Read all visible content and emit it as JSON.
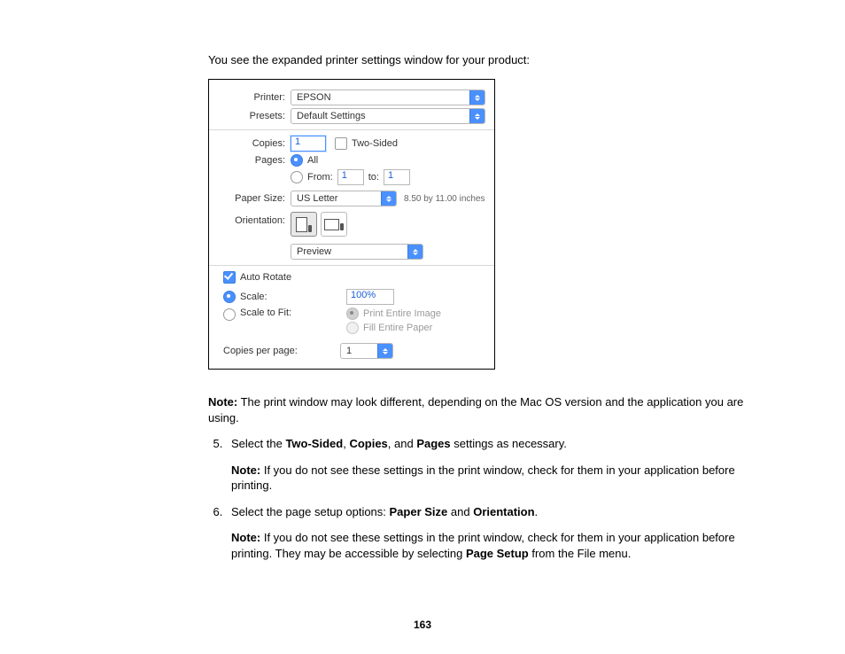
{
  "intro": "You see the expanded printer settings window for your product:",
  "dialog": {
    "printerLabel": "Printer:",
    "printerValue": "EPSON",
    "presetsLabel": "Presets:",
    "presetsValue": "Default Settings",
    "copiesLabel": "Copies:",
    "copiesValue": "1",
    "twoSidedLabel": "Two-Sided",
    "pagesLabel": "Pages:",
    "pagesAll": "All",
    "pagesFrom": "From:",
    "pagesFromValue": "1",
    "pagesTo": "to:",
    "pagesToValue": "1",
    "paperSizeLabel": "Paper Size:",
    "paperSizeValue": "US Letter",
    "paperSizeDims": "8.50 by 11.00 inches",
    "orientationLabel": "Orientation:",
    "panelSelect": "Preview",
    "autoRotate": "Auto Rotate",
    "scaleLabel": "Scale:",
    "scaleValue": "100%",
    "scaleToFitLabel": "Scale to Fit:",
    "printEntire": "Print Entire Image",
    "fillEntire": "Fill Entire Paper",
    "copiesPerPageLabel": "Copies per page:",
    "copiesPerPageValue": "1"
  },
  "noteWord": "Note:",
  "note1": " The print window may look different, depending on the Mac OS version and the application you are using.",
  "step5_a": "Select the ",
  "step5_b1": "Two-Sided",
  "step5_c": ", ",
  "step5_b2": "Copies",
  "step5_d": ", and ",
  "step5_b3": "Pages",
  "step5_e": " settings as necessary.",
  "note2": " If you do not see these settings in the print window, check for them in your application before printing.",
  "step6_a": "Select the page setup options: ",
  "step6_b1": "Paper Size",
  "step6_c": " and ",
  "step6_b2": "Orientation",
  "step6_d": ".",
  "note3_a": " If you do not see these settings in the print window, check for them in your application before printing. They may be accessible by selecting ",
  "note3_b": "Page Setup",
  "note3_c": " from the File menu.",
  "pageNumber": "163"
}
